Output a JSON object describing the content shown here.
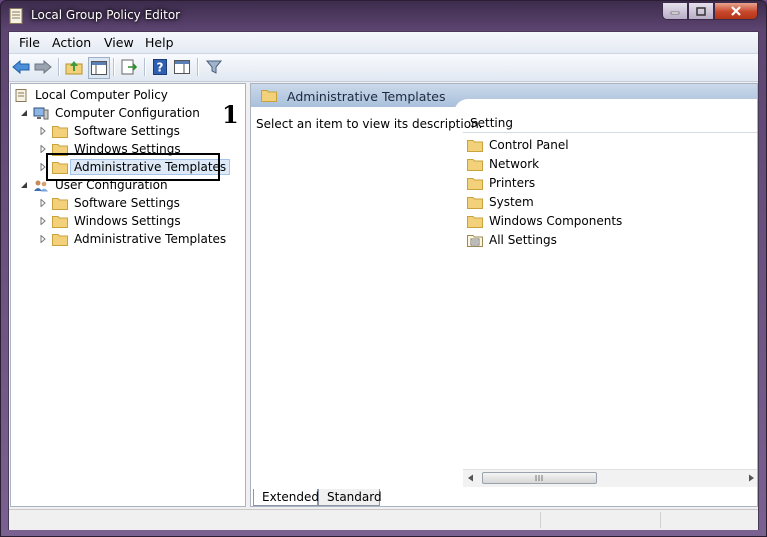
{
  "window": {
    "title": "Local Group Policy Editor"
  },
  "menu": [
    "File",
    "Action",
    "View",
    "Help"
  ],
  "tree": {
    "root": "Local Computer Policy",
    "computer_configuration": {
      "label": "Computer Configuration",
      "children": [
        "Software Settings",
        "Windows Settings",
        "Administrative Templates"
      ]
    },
    "user_configuration": {
      "label": "User Configuration",
      "children": [
        "Software Settings",
        "Windows Settings",
        "Administrative Templates"
      ]
    }
  },
  "callout": {
    "number": "1"
  },
  "details": {
    "header_title": "Administrative Templates",
    "description_prompt": "Select an item to view its description.",
    "column_header": "Setting",
    "items": [
      "Control Panel",
      "Network",
      "Printers",
      "System",
      "Windows Components",
      "All Settings"
    ]
  },
  "tabs": [
    "Extended",
    "Standard"
  ],
  "colors": {
    "accent": "#a9c0dc",
    "folder": "#f2d17a",
    "selection": "#dde9f7"
  }
}
